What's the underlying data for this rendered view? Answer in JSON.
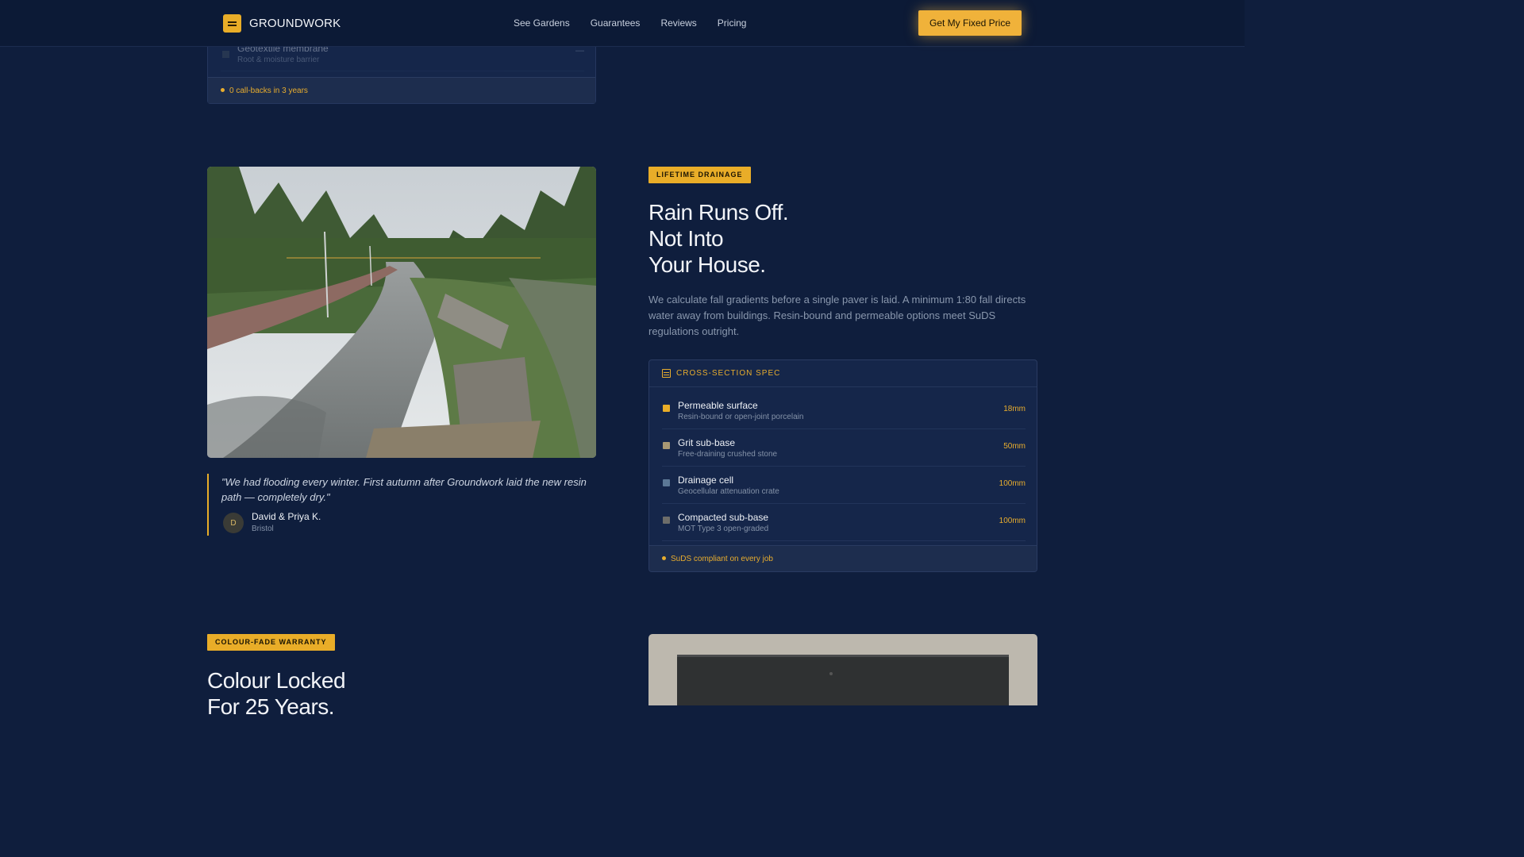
{
  "nav": {
    "brand": "GROUNDWORK",
    "links": [
      "See Gardens",
      "Guarantees",
      "Reviews",
      "Pricing"
    ],
    "cta": "Get My Fixed Price"
  },
  "prev_card": {
    "item_name": "Geotextile membrane",
    "item_desc": "Root & moisture barrier",
    "item_value": "—",
    "footer": "0 call-backs in 3 years"
  },
  "drainage": {
    "badge": "LIFETIME DRAINAGE",
    "headline_1": "Rain Runs Off.",
    "headline_2": "Not Into",
    "headline_3": "Your House.",
    "body": "We calculate fall gradients before a single paver is laid. A minimum 1:80 fall directs water away from buildings. Resin-bound and permeable options meet SuDS regulations outright.",
    "quote": "\"We had flooding every winter. First autumn after Groundwork laid the new resin path — completely dry.\"",
    "author_initial": "D",
    "author_name": "David & Priya K.",
    "author_city": "Bristol",
    "spec": {
      "title": "CROSS-SECTION SPEC",
      "rows": [
        {
          "name": "Permeable surface",
          "desc": "Resin-bound or open-joint porcelain",
          "depth": "18mm",
          "color": "#e9ad28"
        },
        {
          "name": "Grit sub-base",
          "desc": "Free-draining crushed stone",
          "depth": "50mm",
          "color": "#a89874"
        },
        {
          "name": "Drainage cell",
          "desc": "Geocellular attenuation crate",
          "depth": "100mm",
          "color": "#5c7896"
        },
        {
          "name": "Compacted sub-base",
          "desc": "MOT Type 3 open-graded",
          "depth": "100mm",
          "color": "#6d6d6a"
        }
      ],
      "footer": "SuDS compliant on every job"
    }
  },
  "colour": {
    "badge": "COLOUR-FADE WARRANTY",
    "headline_1": "Colour Locked",
    "headline_2": "For 25 Years."
  }
}
